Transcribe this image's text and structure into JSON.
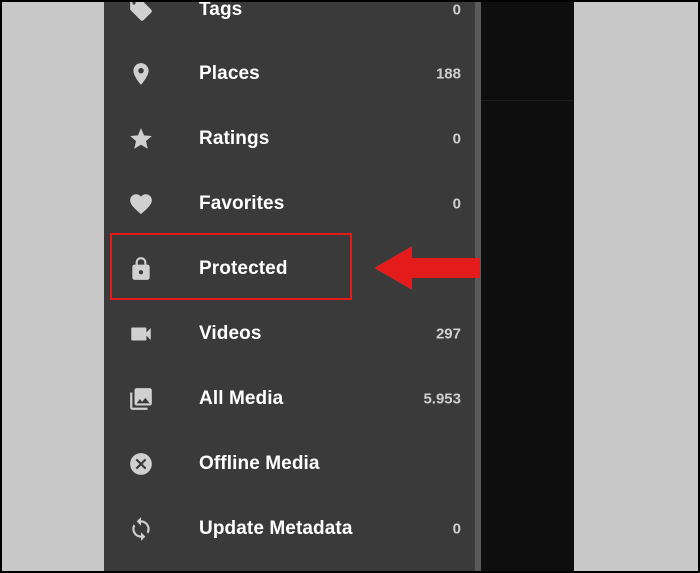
{
  "drawer": {
    "items": [
      {
        "label": "Tags",
        "count": "0",
        "icon": "tag-icon"
      },
      {
        "label": "Places",
        "count": "188",
        "icon": "location-pin-icon"
      },
      {
        "label": "Ratings",
        "count": "0",
        "icon": "star-icon"
      },
      {
        "label": "Favorites",
        "count": "0",
        "icon": "heart-icon"
      },
      {
        "label": "Protected",
        "count": "",
        "icon": "lock-icon"
      },
      {
        "label": "Videos",
        "count": "297",
        "icon": "video-camera-icon"
      },
      {
        "label": "All Media",
        "count": "5.953",
        "icon": "photo-library-icon"
      },
      {
        "label": "Offline Media",
        "count": "",
        "icon": "offline-x-icon"
      },
      {
        "label": "Update Metadata",
        "count": "0",
        "icon": "sync-icon"
      }
    ]
  },
  "annotation": {
    "highlight_color": "#e31b1b",
    "arrow_color": "#e31b1b",
    "target": "Protected"
  },
  "colors": {
    "drawer_bg": "#3a3a3a",
    "icon": "#d0d0d0",
    "label": "#ffffff",
    "count": "#cfcfcf"
  }
}
